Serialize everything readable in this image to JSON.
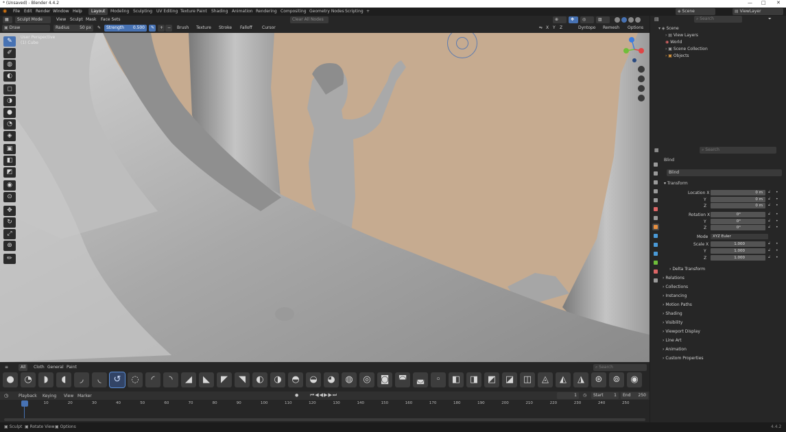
{
  "window": {
    "title": "* (Unsaved) - Blender 4.4.2",
    "minimize": "—",
    "maximize": "□",
    "close": "✕"
  },
  "menu": [
    "File",
    "Edit",
    "Render",
    "Window",
    "Help"
  ],
  "workspaces": [
    "Layout",
    "Modeling",
    "Sculpting",
    "UV Editing",
    "Texture Paint",
    "Shading",
    "Animation",
    "Rendering",
    "Compositing",
    "Geometry Nodes",
    "Scripting"
  ],
  "workspace_add": "+",
  "scene": {
    "label": "Scene",
    "view_layer": "ViewLayer"
  },
  "viewport_header": {
    "mode": "Sculpt Mode",
    "menus": [
      "View",
      "Sculpt",
      "Mask",
      "Face Sets"
    ],
    "clear_all_nodes": "Clear All Nodes",
    "axes": [
      "X",
      "Y",
      "Z"
    ],
    "dyntopo": "Dyntopo",
    "remesh": "Remesh",
    "options": "Options"
  },
  "tool_header": {
    "brush": "Draw",
    "radius_label": "Radius",
    "radius_value": "50 px",
    "strength_label": "Strength",
    "strength_value": "0.500",
    "plus": "+",
    "minus": "−",
    "menus": [
      "Brush",
      "Texture",
      "Stroke",
      "Falloff",
      "Cursor"
    ]
  },
  "overlay_text": {
    "line1": "User Perspective",
    "line2": "(1) Cube"
  },
  "outliner": {
    "search_placeholder": "Search",
    "items": [
      "Scene",
      "View Layers",
      "World",
      "Scene Collection",
      "Objects"
    ]
  },
  "properties": {
    "search_placeholder": "Search",
    "object_name": "Blind",
    "data_name": "Blind",
    "transform_title": "Transform",
    "location": {
      "label": "Location X",
      "y": "Y",
      "z": "Z",
      "values": [
        "0 m",
        "0 m",
        "0 m"
      ]
    },
    "rotation": {
      "label": "Rotation X",
      "y": "Y",
      "z": "Z",
      "values": [
        "0°",
        "0°",
        "0°"
      ]
    },
    "mode": {
      "label": "Mode",
      "value": "XYZ Euler"
    },
    "scale": {
      "label": "Scale X",
      "y": "Y",
      "z": "Z",
      "values": [
        "1.000",
        "1.000",
        "1.000"
      ]
    },
    "delta": "Delta Transform",
    "sections": [
      "Relations",
      "Collections",
      "Instancing",
      "Motion Paths",
      "Shading",
      "Visibility",
      "Viewport Display",
      "Line Art",
      "Animation",
      "Custom Properties"
    ]
  },
  "asset_tabs": [
    "All",
    "Cloth",
    "General",
    "Paint"
  ],
  "asset_search_placeholder": "Search",
  "timeline": {
    "menus": [
      "Playback",
      "Keying",
      "View",
      "Marker"
    ],
    "current_frame": "1",
    "start_label": "Start",
    "start": "1",
    "end_label": "End",
    "end": "250",
    "ticks": [
      "1",
      "10",
      "20",
      "30",
      "40",
      "50",
      "60",
      "70",
      "80",
      "90",
      "100",
      "110",
      "120",
      "130",
      "140",
      "150",
      "160",
      "170",
      "180",
      "190",
      "200",
      "210",
      "220",
      "230",
      "240",
      "250"
    ]
  },
  "statusbar": {
    "items": [
      "Sculpt",
      "Rotate View",
      "Options"
    ],
    "version": "4.4.2"
  },
  "colors": {
    "accent": "#4772b3",
    "bg": "#1d1d1d",
    "panel": "#262626",
    "viewport_bg": "#c6ab90",
    "mesh": "#b5b5b5"
  }
}
